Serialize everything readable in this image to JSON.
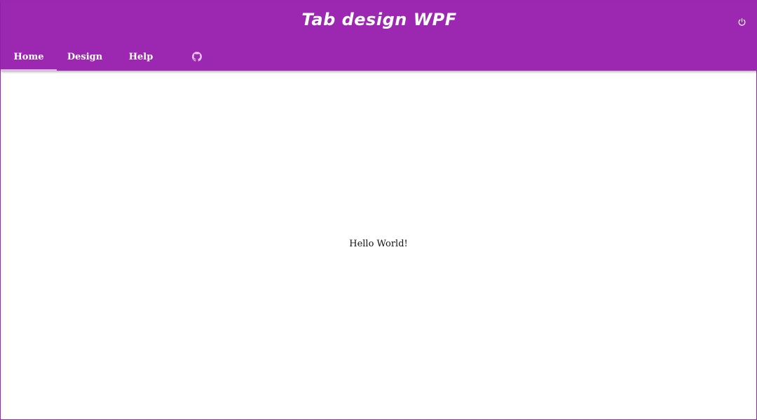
{
  "app": {
    "title": "Tab design WPF"
  },
  "header": {
    "power_icon": "power-icon"
  },
  "tabs": [
    {
      "label": "Home",
      "active": true
    },
    {
      "label": "Design",
      "active": false
    },
    {
      "label": "Help",
      "active": false
    },
    {
      "icon": "github-icon",
      "active": false
    }
  ],
  "content": {
    "text": "Hello World!"
  },
  "colors": {
    "primary": "#9c27b0",
    "indicator": "#e1bee7",
    "text_on_primary": "#ffffff"
  }
}
